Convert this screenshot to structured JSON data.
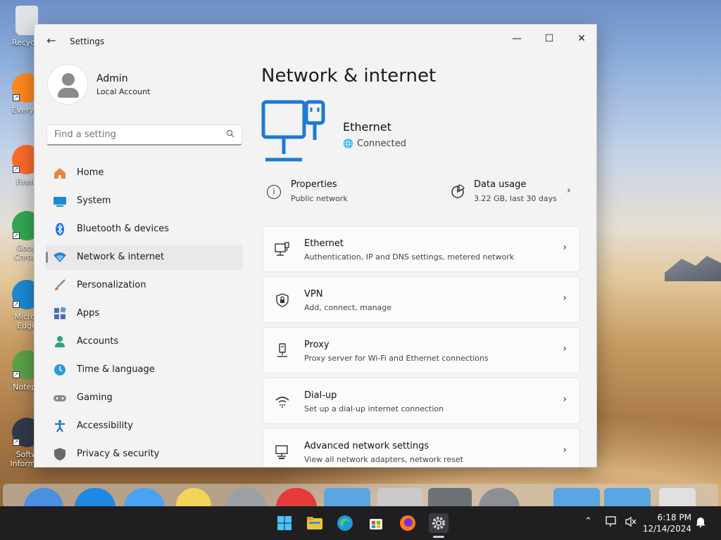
{
  "desktop": {
    "icons": [
      {
        "label": "Recycle",
        "name": "recycle-bin-icon"
      },
      {
        "label": "Everyth",
        "name": "everything-icon"
      },
      {
        "label": "Firefo",
        "name": "firefox-desktop-icon"
      },
      {
        "label": "Goog\nChrom",
        "name": "chrome-desktop-icon"
      },
      {
        "label": "Micros\nEdge",
        "name": "edge-desktop-icon"
      },
      {
        "label": "Notepa",
        "name": "notepad-desktop-icon"
      },
      {
        "label": "Softw\nInformer",
        "name": "software-informer-desktop-icon"
      }
    ]
  },
  "window": {
    "title": "Settings",
    "controls": {
      "minimize": "—",
      "maximize": "☐",
      "close": "✕"
    }
  },
  "profile": {
    "name": "Admin",
    "type": "Local Account"
  },
  "search": {
    "placeholder": "Find a setting"
  },
  "nav": [
    {
      "label": "Home",
      "icon": "home-icon",
      "color": "#e8863a"
    },
    {
      "label": "System",
      "icon": "system-icon",
      "color": "#1b8ad3"
    },
    {
      "label": "Bluetooth & devices",
      "icon": "bluetooth-icon",
      "color": "#1a73e8"
    },
    {
      "label": "Network & internet",
      "icon": "network-icon",
      "color": "#2a84d6",
      "active": true
    },
    {
      "label": "Personalization",
      "icon": "brush-icon",
      "color": "#c77a3a"
    },
    {
      "label": "Apps",
      "icon": "apps-icon",
      "color": "#4b6fb5"
    },
    {
      "label": "Accounts",
      "icon": "accounts-icon",
      "color": "#2aa774"
    },
    {
      "label": "Time & language",
      "icon": "time-language-icon",
      "color": "#2d9ad6"
    },
    {
      "label": "Gaming",
      "icon": "gaming-icon",
      "color": "#8a8a8a"
    },
    {
      "label": "Accessibility",
      "icon": "accessibility-icon",
      "color": "#1a6fd0"
    },
    {
      "label": "Privacy & security",
      "icon": "shield-icon",
      "color": "#6b6b6b"
    }
  ],
  "main": {
    "title": "Network & internet",
    "hero": {
      "title": "Ethernet",
      "status": "Connected"
    },
    "properties": {
      "title": "Properties",
      "sub": "Public network"
    },
    "data_usage": {
      "title": "Data usage",
      "sub": "3.22 GB, last 30 days"
    },
    "cards": [
      {
        "title": "Ethernet",
        "sub": "Authentication, IP and DNS settings, metered network",
        "icon": "ethernet-icon"
      },
      {
        "title": "VPN",
        "sub": "Add, connect, manage",
        "icon": "vpn-shield-icon"
      },
      {
        "title": "Proxy",
        "sub": "Proxy server for Wi-Fi and Ethernet connections",
        "icon": "proxy-icon"
      },
      {
        "title": "Dial-up",
        "sub": "Set up a dial-up internet connection",
        "icon": "dialup-icon"
      },
      {
        "title": "Advanced network settings",
        "sub": "View all network adapters, network reset",
        "icon": "advanced-network-icon"
      }
    ]
  },
  "taskbar": {
    "clock_time": "6:18 PM",
    "clock_date": "12/14/2024"
  },
  "colors": {
    "accent": "#1b7bd6",
    "window_bg": "#f3f3f3",
    "taskbar": "#1f1f22"
  }
}
